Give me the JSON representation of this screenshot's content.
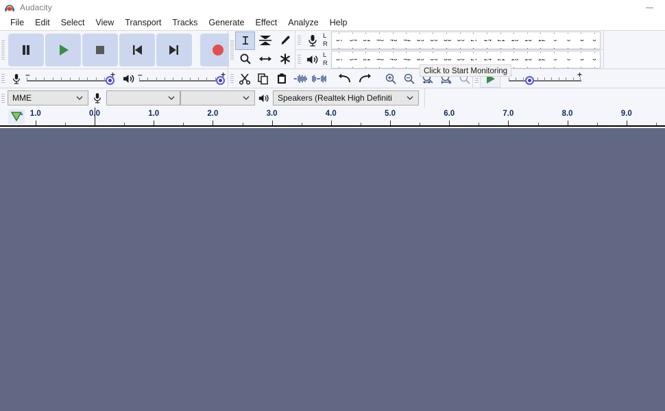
{
  "window": {
    "title": "Audacity",
    "logo_icon": "audacity-headphones-logo",
    "minimize_icon": "minimize-icon"
  },
  "menubar": {
    "items": [
      {
        "label": "File"
      },
      {
        "label": "Edit"
      },
      {
        "label": "Select"
      },
      {
        "label": "View"
      },
      {
        "label": "Transport"
      },
      {
        "label": "Tracks"
      },
      {
        "label": "Generate"
      },
      {
        "label": "Effect"
      },
      {
        "label": "Analyze"
      },
      {
        "label": "Help"
      }
    ]
  },
  "transport": {
    "buttons": [
      {
        "name": "pause",
        "icon": "pause-icon"
      },
      {
        "name": "play",
        "icon": "play-icon"
      },
      {
        "name": "stop",
        "icon": "stop-icon"
      },
      {
        "name": "skip-to-start",
        "icon": "skip-start-icon"
      },
      {
        "name": "skip-to-end",
        "icon": "skip-end-icon"
      },
      {
        "name": "record",
        "icon": "record-icon"
      }
    ]
  },
  "tools": {
    "buttons": [
      {
        "name": "selection-tool",
        "icon": "i-beam-icon",
        "selected": true
      },
      {
        "name": "envelope-tool",
        "icon": "envelope-icon",
        "selected": false
      },
      {
        "name": "draw-tool",
        "icon": "pencil-icon",
        "selected": false
      },
      {
        "name": "zoom-tool",
        "icon": "magnifier-icon",
        "selected": false
      },
      {
        "name": "time-shift-tool",
        "icon": "double-arrow-icon",
        "selected": false
      },
      {
        "name": "multi-tool",
        "icon": "asterisk-icon",
        "selected": false
      }
    ]
  },
  "meters": {
    "record": {
      "icon": "microphone-icon",
      "channel_labels": [
        "L",
        "R"
      ],
      "scale": [
        "-57",
        "-54",
        "-51",
        "-48",
        "-45",
        "-42",
        "-39",
        "-36",
        "-33",
        "-30",
        "-27",
        "-24",
        "-21",
        "-18",
        "-15",
        "-12",
        "-9",
        "-6",
        "-3",
        "0"
      ]
    },
    "play": {
      "icon": "speaker-icon",
      "channel_labels": [
        "L",
        "R"
      ],
      "scale": [
        "-57",
        "-54",
        "-51",
        "-48",
        "-45",
        "-42",
        "-39",
        "-36",
        "-33",
        "-30",
        "-27",
        "-24",
        "-21",
        "-18",
        "-15",
        "-12",
        "-9",
        "-6",
        "-3",
        "0"
      ]
    }
  },
  "tooltip": {
    "text": "Click to Start Monitoring"
  },
  "mixer": {
    "record_volume": {
      "icon": "microphone-icon",
      "minus": "–",
      "plus": "+",
      "value_pct": 100
    },
    "playback_volume": {
      "icon": "speaker-icon",
      "minus": "–",
      "plus": "+",
      "value_pct": 100
    }
  },
  "edit": {
    "buttons": [
      {
        "name": "cut",
        "icon": "scissors-icon"
      },
      {
        "name": "copy",
        "icon": "copy-icon"
      },
      {
        "name": "paste",
        "icon": "clipboard-icon"
      },
      {
        "name": "trim-audio-outside-selection",
        "icon": "trim-outside-icon"
      },
      {
        "name": "silence-audio-selection",
        "icon": "silence-selection-icon"
      },
      {
        "name": "undo",
        "icon": "undo-arrow-icon"
      },
      {
        "name": "redo",
        "icon": "redo-arrow-icon"
      },
      {
        "name": "zoom-in",
        "icon": "zoom-in-icon"
      },
      {
        "name": "zoom-out",
        "icon": "zoom-out-icon"
      },
      {
        "name": "fit-selection-to-width",
        "icon": "fit-selection-icon"
      },
      {
        "name": "fit-project-to-width",
        "icon": "fit-project-icon"
      },
      {
        "name": "zoom-toggle",
        "icon": "zoom-toggle-icon"
      }
    ]
  },
  "play_at_speed": {
    "play_icon": "play-at-speed-icon",
    "minus": "–",
    "plus": "+",
    "value_pct": 26
  },
  "device": {
    "host": {
      "value": "MME",
      "caret": "chevron-down-icon"
    },
    "recording_device": {
      "value": "",
      "icon": "microphone-icon",
      "caret": "chevron-down-icon"
    },
    "recording_channels": {
      "value": "",
      "caret": "chevron-down-icon"
    },
    "playback_device": {
      "value": "Speakers (Realtek High Definiti",
      "icon": "speaker-icon",
      "caret": "chevron-down-icon"
    }
  },
  "ruler": {
    "pin_icon": "pinned-play-head-icon",
    "negative_sign": "-",
    "labels": [
      "1.0",
      "0.0",
      "1.0",
      "2.0",
      "3.0",
      "4.0",
      "5.0",
      "6.0",
      "7.0",
      "8.0",
      "9.0"
    ],
    "cursor_position_label": "0.0"
  },
  "colors": {
    "track_background": "#626884",
    "toolbar_background": "#f5f6fb",
    "button_face": "#ccd7ef",
    "record_red": "#e0504e",
    "play_green": "#3c8c46",
    "slider_thumb": "#3a3ad0",
    "ruler_text": "#102a66"
  }
}
